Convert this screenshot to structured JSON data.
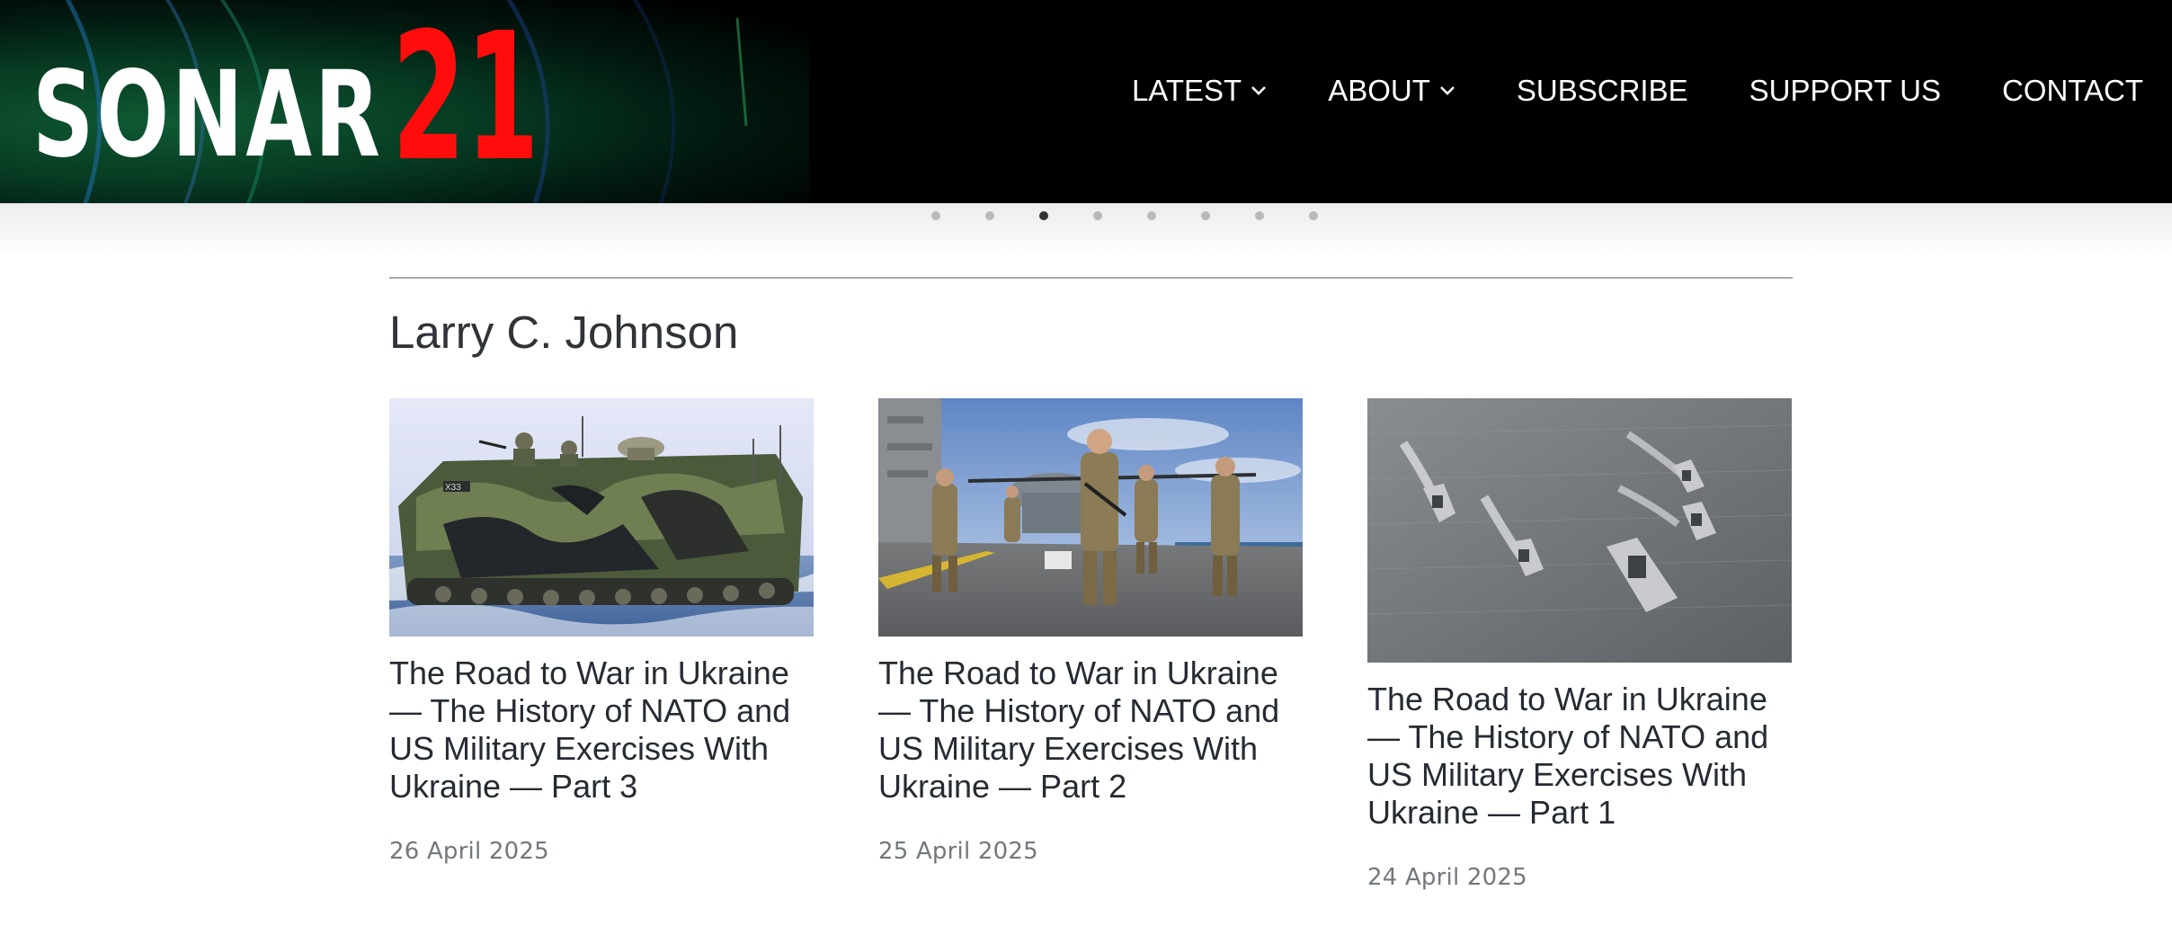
{
  "site": {
    "logo_text": "SONAR",
    "logo_number": "21",
    "logo_number_color": "#ff0d0d",
    "header_background": "#000000"
  },
  "nav": {
    "items": [
      {
        "label": "LATEST",
        "has_dropdown": true,
        "icon": "chevron-down-icon"
      },
      {
        "label": "ABOUT",
        "has_dropdown": true,
        "icon": "chevron-down-icon"
      },
      {
        "label": "SUBSCRIBE",
        "has_dropdown": false
      },
      {
        "label": "SUPPORT US",
        "has_dropdown": false
      },
      {
        "label": "CONTACT",
        "has_dropdown": false
      }
    ]
  },
  "carousel": {
    "dot_count": 8,
    "active_index": 2
  },
  "section": {
    "author": "Larry C. Johnson"
  },
  "posts": [
    {
      "title": "The Road to War in Ukraine — The History of NATO and US Military Exercises With Ukraine — Part 3",
      "date": "26 April 2025",
      "image": "amphibious-assault-vehicle-photo"
    },
    {
      "title": "The Road to War in Ukraine — The History of NATO and US Military Exercises With Ukraine — Part 2",
      "date": "25 April 2025",
      "image": "marines-on-flight-deck-photo"
    },
    {
      "title": "The Road to War in Ukraine — The History of NATO and US Military Exercises With Ukraine — Part 1",
      "date": "24 April 2025",
      "image": "naval-ships-formation-photo"
    }
  ],
  "colors": {
    "title_text": "#262b33",
    "date_text": "#73777e",
    "divider": "#a9a9a9"
  }
}
